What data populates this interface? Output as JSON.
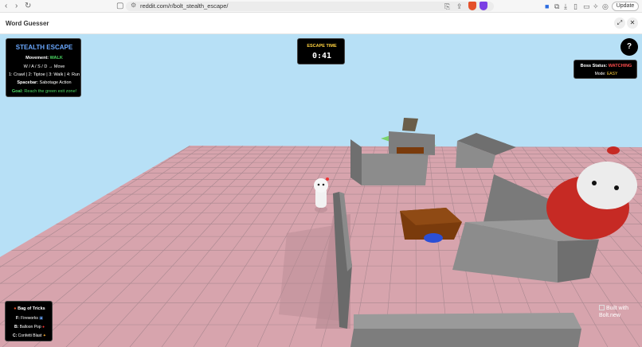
{
  "browser": {
    "url": "reddit.com/r/bolt_stealth_escape/",
    "update_label": "Update"
  },
  "app": {
    "title": "Word Guesser"
  },
  "hud": {
    "stealth": {
      "title": "STEALTH ESCAPE",
      "movement_label": "Movement:",
      "movement_value": "WALK",
      "keys_line": "W / A / S / D → Move",
      "speed_1": "1: Crawl",
      "speed_2": "2: Tiptoe",
      "speed_3": "3: Walk",
      "speed_4": "4: Run",
      "spacebar_key": "Spacebar:",
      "spacebar_action": "Sabotage Action",
      "goal_label": "Goal:",
      "goal_text": "Reach the green exit zone!"
    },
    "timer": {
      "label": "ESCAPE TIME",
      "value": "0:41"
    },
    "help_label": "?",
    "boss": {
      "status_label": "Boss Status:",
      "status_value": "WATCHING",
      "mode_label": "Mode:",
      "mode_value": "EASY"
    },
    "bag": {
      "title": "Bag of Tricks",
      "items": [
        {
          "key": "F:",
          "label": "Fireworks"
        },
        {
          "key": "B:",
          "label": "Balloon Pop"
        },
        {
          "key": "C:",
          "label": "Confetti Blast"
        }
      ]
    },
    "built_with": "Built with Bolt.new"
  },
  "colors": {
    "sky": "#b7e0f6",
    "floor": "#d7a4ad",
    "grid": "#9c7c83",
    "wall": "#7d7d7d",
    "crate": "#7a3b0c",
    "boss_body": "#c62a24",
    "exit_zone": "#7bd36b"
  }
}
